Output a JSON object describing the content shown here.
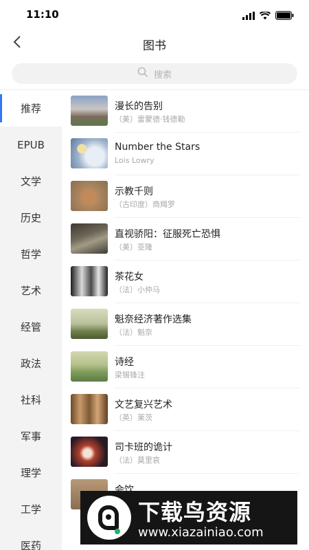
{
  "status": {
    "time": "11:10"
  },
  "nav": {
    "title": "图书"
  },
  "search": {
    "placeholder": "搜索"
  },
  "sidebar": {
    "items": [
      {
        "label": "推荐",
        "active": true
      },
      {
        "label": "EPUB"
      },
      {
        "label": "文学"
      },
      {
        "label": "历史"
      },
      {
        "label": "哲学"
      },
      {
        "label": "艺术"
      },
      {
        "label": "经管"
      },
      {
        "label": "政法"
      },
      {
        "label": "社科"
      },
      {
        "label": "军事"
      },
      {
        "label": "理学"
      },
      {
        "label": "工学"
      },
      {
        "label": "医药"
      }
    ]
  },
  "books": [
    {
      "title": "漫长的告别",
      "author": "（美）雷蒙德·钱德勒"
    },
    {
      "title": "Number the Stars",
      "author": "Lois Lowry"
    },
    {
      "title": "示教千则",
      "author": "（古印度）商羯罗"
    },
    {
      "title": "直视骄阳：征服死亡恐惧",
      "author": "（美）亚隆"
    },
    {
      "title": "茶花女",
      "author": "（法）小仲马"
    },
    {
      "title": "魁奈经济著作选集",
      "author": "（法）魁奈"
    },
    {
      "title": "诗经",
      "author": "梁锡锋注"
    },
    {
      "title": "文艺复兴艺术",
      "author": "（英）莱茨"
    },
    {
      "title": "司卡班的诡计",
      "author": "（法）莫里哀"
    },
    {
      "title": "会饮",
      "author": ""
    }
  ],
  "watermark": {
    "title": "下载鸟资源",
    "url": "www.xiazainiao.com"
  },
  "colors": {
    "accent": "#3478f6",
    "sidebar_bg": "#f3f3f3"
  }
}
